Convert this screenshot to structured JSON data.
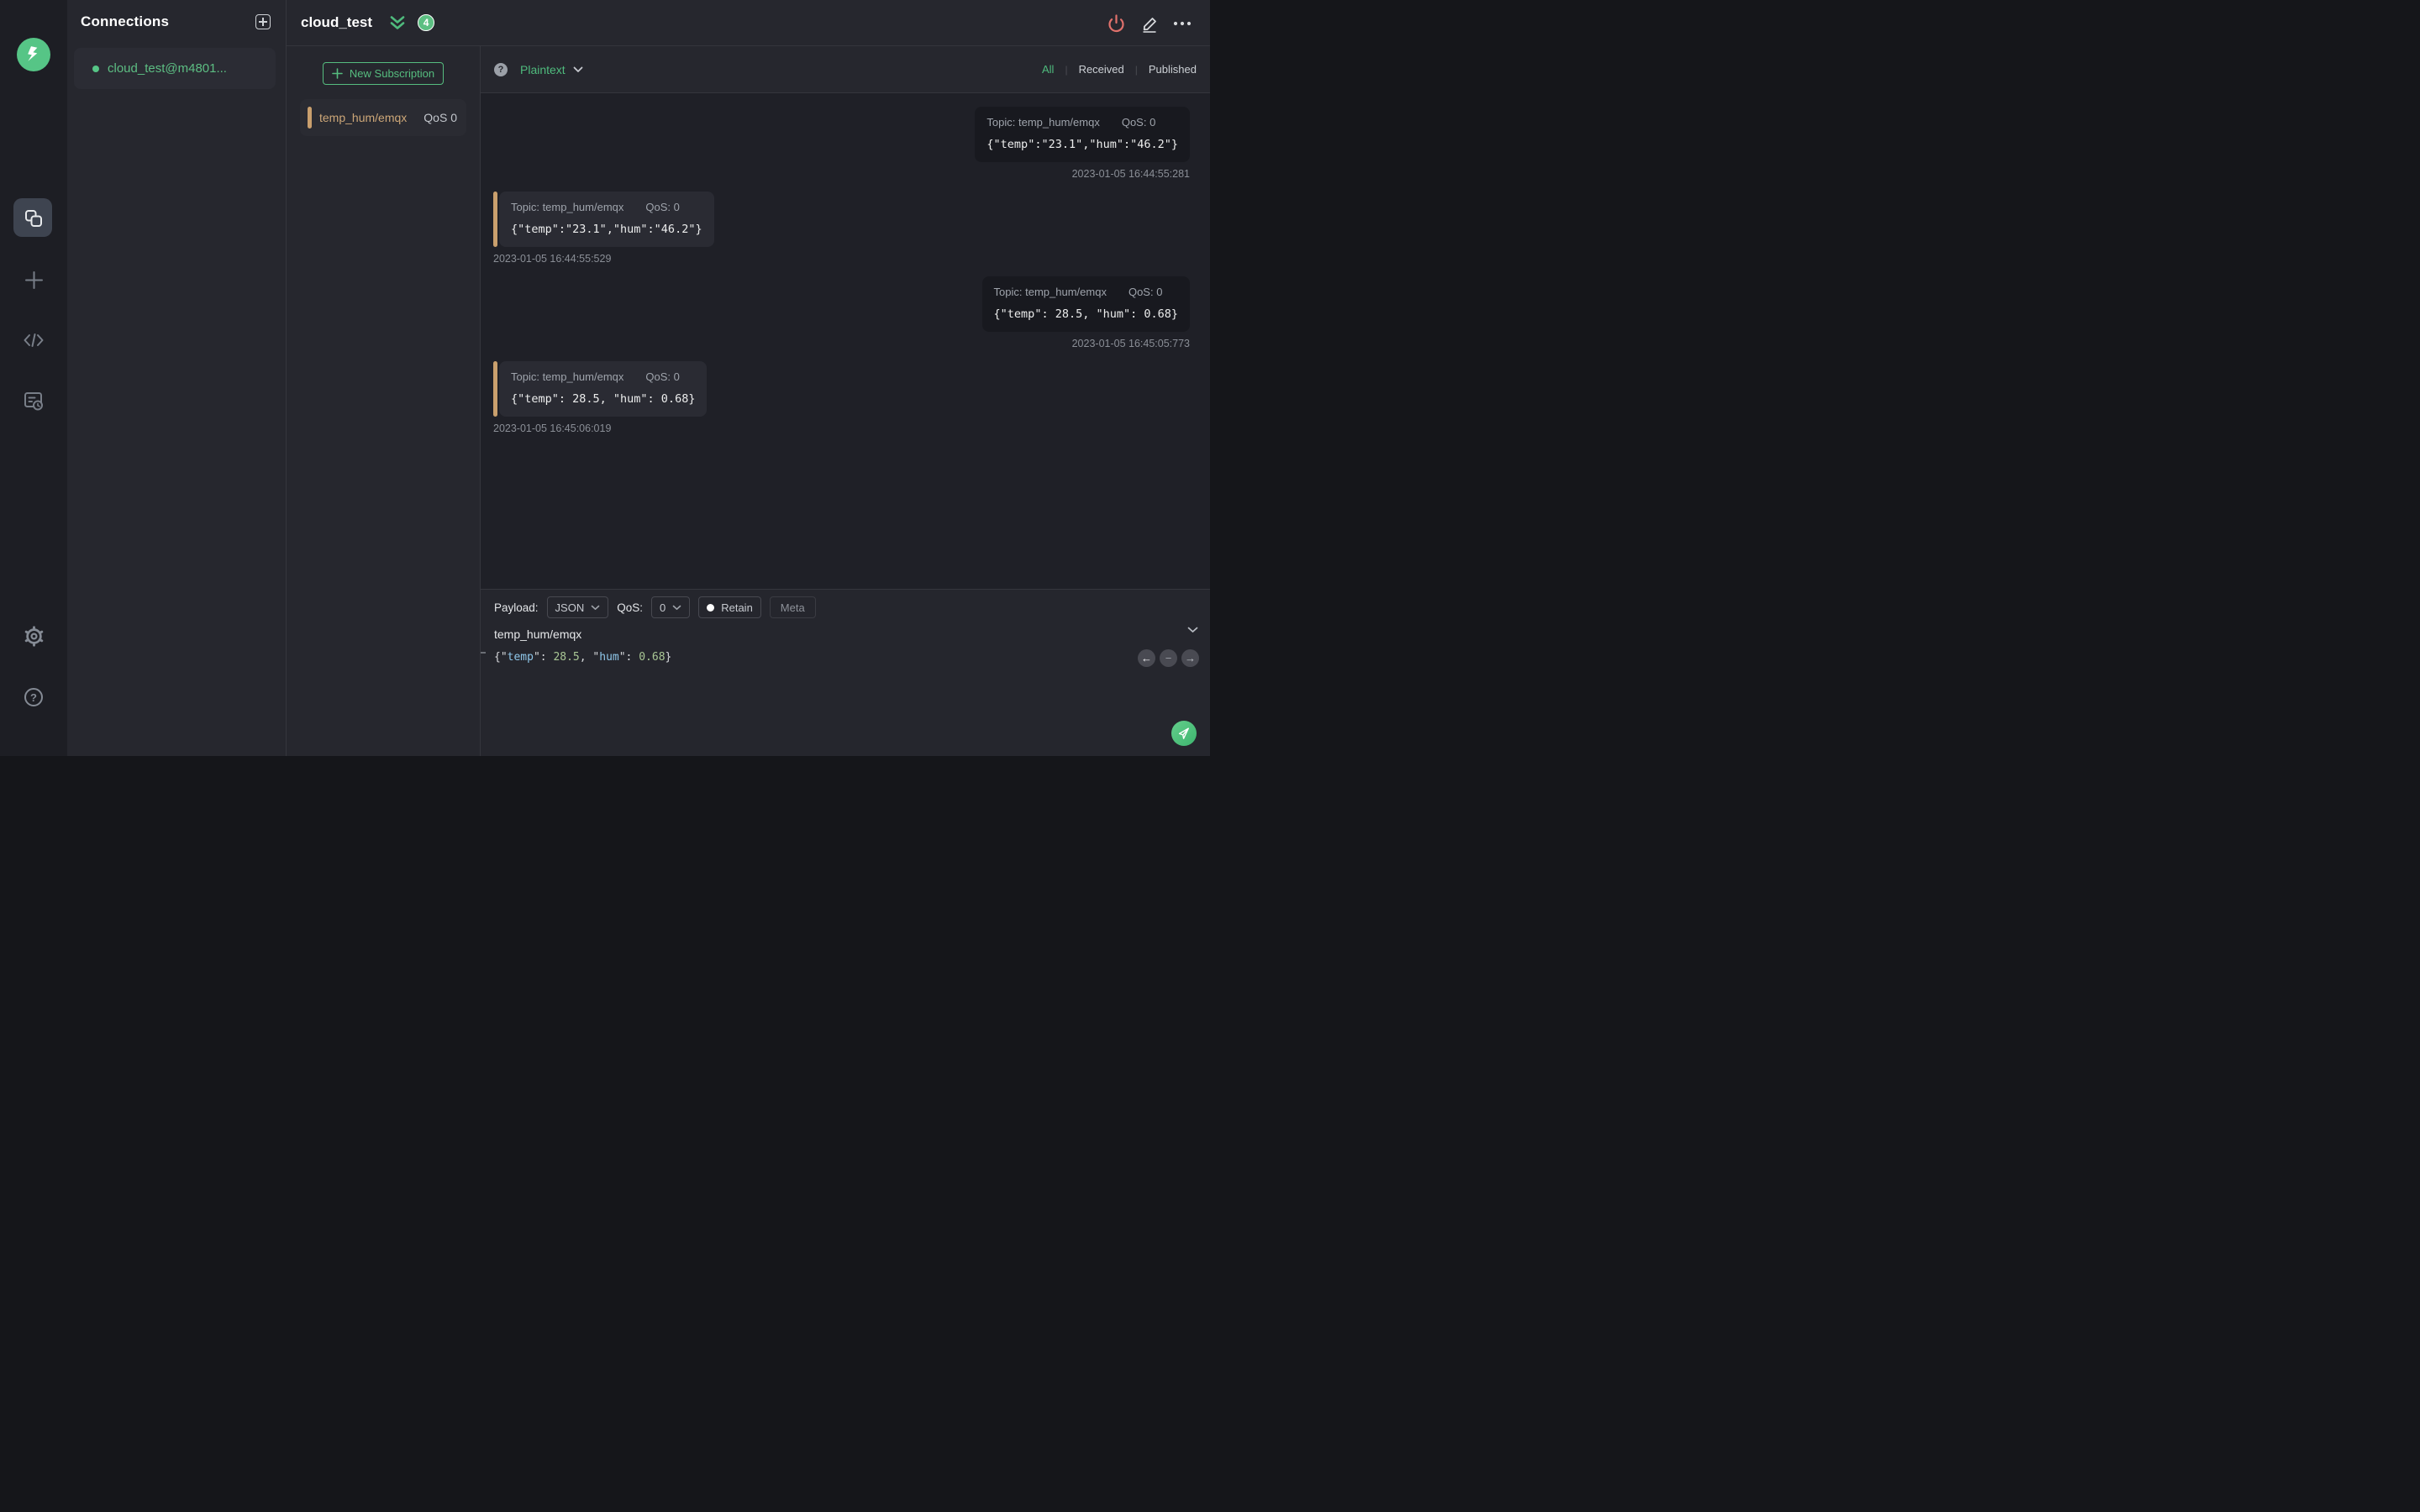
{
  "connections_panel": {
    "title": "Connections",
    "items": [
      {
        "label": "cloud_test@m4801...",
        "status": "connected",
        "active": true
      }
    ]
  },
  "header": {
    "title": "cloud_test",
    "unread_badge": "4"
  },
  "subscriptions": {
    "new_button_label": "New Subscription",
    "items": [
      {
        "topic": "temp_hum/emqx",
        "qos": "QoS 0"
      }
    ]
  },
  "message_toolbar": {
    "format": "Plaintext",
    "filters": {
      "all": "All",
      "received": "Received",
      "published": "Published"
    },
    "active_filter": "All"
  },
  "messages": {
    "items": [
      {
        "direction": "published",
        "topic_label": "Topic: temp_hum/emqx",
        "qos_label": "QoS: 0",
        "payload": "{\"temp\":\"23.1\",\"hum\":\"46.2\"}",
        "timestamp": "2023-01-05 16:44:55:281"
      },
      {
        "direction": "received",
        "topic_label": "Topic: temp_hum/emqx",
        "qos_label": "QoS: 0",
        "payload": "{\"temp\":\"23.1\",\"hum\":\"46.2\"}",
        "timestamp": "2023-01-05 16:44:55:529"
      },
      {
        "direction": "published",
        "topic_label": "Topic: temp_hum/emqx",
        "qos_label": "QoS: 0",
        "payload": "{\"temp\": 28.5, \"hum\": 0.68}",
        "timestamp": "2023-01-05 16:45:05:773"
      },
      {
        "direction": "received",
        "topic_label": "Topic: temp_hum/emqx",
        "qos_label": "QoS: 0",
        "payload": "{\"temp\": 28.5, \"hum\": 0.68}",
        "timestamp": "2023-01-05 16:45:06:019"
      }
    ]
  },
  "publish": {
    "payload_label": "Payload:",
    "payload_type": "JSON",
    "qos_label": "QoS:",
    "qos_value": "0",
    "retain_label": "Retain",
    "meta_label": "Meta",
    "topic": "temp_hum/emqx",
    "editor_tokens": [
      {
        "text": "{\"",
        "type": "punct"
      },
      {
        "text": "temp",
        "type": "key"
      },
      {
        "text": "\": ",
        "type": "punct"
      },
      {
        "text": "28.5",
        "type": "num"
      },
      {
        "text": ", \"",
        "type": "punct"
      },
      {
        "text": "hum",
        "type": "key"
      },
      {
        "text": "\": ",
        "type": "punct"
      },
      {
        "text": "0.68",
        "type": "num"
      },
      {
        "text": "}",
        "type": "punct"
      }
    ]
  },
  "icons": {
    "mqttx-logo": "green circle with white bolt glyph",
    "connections-icon": "overlapping-squares",
    "new-icon": "plus",
    "script-icon": "code-brackets",
    "log-icon": "document-with-clock",
    "settings-icon": "gear",
    "help-icon": "question-circle",
    "disconnect-icon": "power",
    "edit-icon": "pencil",
    "more-icon": "ellipsis",
    "send-icon": "paper-plane"
  },
  "colors": {
    "accent_green": "#4fbb7d",
    "logo_green": "#56c586",
    "badge_green": "#5cbf82",
    "topic_tan": "#c99f6d",
    "disconnect_red": "#e0716c",
    "json_key_blue": "#8fc7ea",
    "json_number_green": "#a9c795",
    "panel_bg": "#26272e",
    "rail_bg": "#1d1e24",
    "messages_bg": "#1f2027",
    "published_card_bg": "#18191f",
    "received_card_bg": "#2a2b33"
  }
}
